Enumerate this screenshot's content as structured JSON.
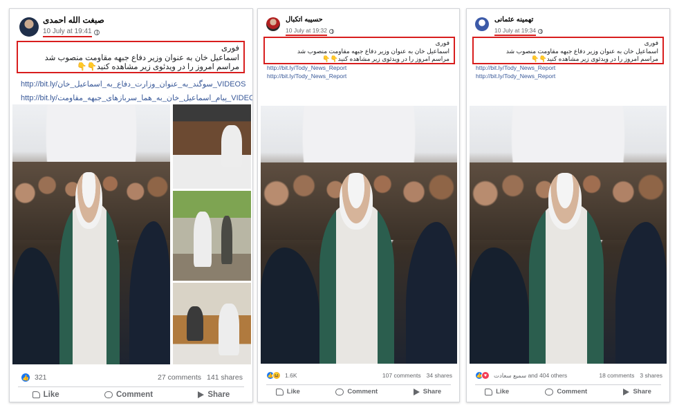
{
  "posts": [
    {
      "author": "صبغت الله احمدی",
      "timestamp": "10 July at 19:41",
      "text_lines": [
        "فوری",
        "اسماعیل خان به عنوان وزیر دفاع جبهه مقاومت منصوب شد",
        "مراسم امروز را در ویدئوی زیر مشاهده کنید👇👇"
      ],
      "links": [
        "http://bit.ly/سوگند_به_عنوان_وزارت_دفاع_به_اسماعیل_خان_VIDEOS",
        "http://bit.ly/پیام_اسماعیل_خان_به_هما_سربازهای_جبهه_مقاومت_VIDEOS"
      ],
      "reactions_count": "321",
      "comments": "27 comments",
      "shares": "141 shares",
      "actions": {
        "like": "Like",
        "comment": "Comment",
        "share": "Share"
      }
    },
    {
      "author": "حسیبه اتکبال",
      "timestamp": "10 July at 19:32",
      "text_lines": [
        "فوری",
        "اسماعیل خان به عنوان وزیر دفاع جبهه مقاومت منصوب شد",
        "مراسم امروز را در ویدئوی زیر مشاهده کنید👇👇"
      ],
      "links": [
        "http://bit.ly/Tody_News_Report",
        "http://bit.ly/Tody_News_Report"
      ],
      "reactions_count": "1.6K",
      "comments": "107 comments",
      "shares": "34 shares",
      "actions": {
        "like": "Like",
        "comment": "Comment",
        "share": "Share"
      }
    },
    {
      "author": "تهمینه عثمانی",
      "timestamp": "10 July at 19:34",
      "text_lines": [
        "فوری",
        "اسماعیل خان به عنوان وزیر دفاع جبهه مقاومت منصوب شد",
        "مراسم امروز را در ویدئوی زیر مشاهده کنید👇👇"
      ],
      "links": [
        "http://bit.ly/Tody_News_Report",
        "http://bit.ly/Tody_News_Report"
      ],
      "reactions_count": "سمیع سعادت and 404 others",
      "comments": "18 comments",
      "shares": "3 shares",
      "actions": {
        "like": "Like",
        "comment": "Comment",
        "share": "Share"
      }
    }
  ],
  "colors": {
    "highlight": "#d81d1d",
    "link": "#385898",
    "like_blue": "#1877f2",
    "muted": "#65676b"
  }
}
